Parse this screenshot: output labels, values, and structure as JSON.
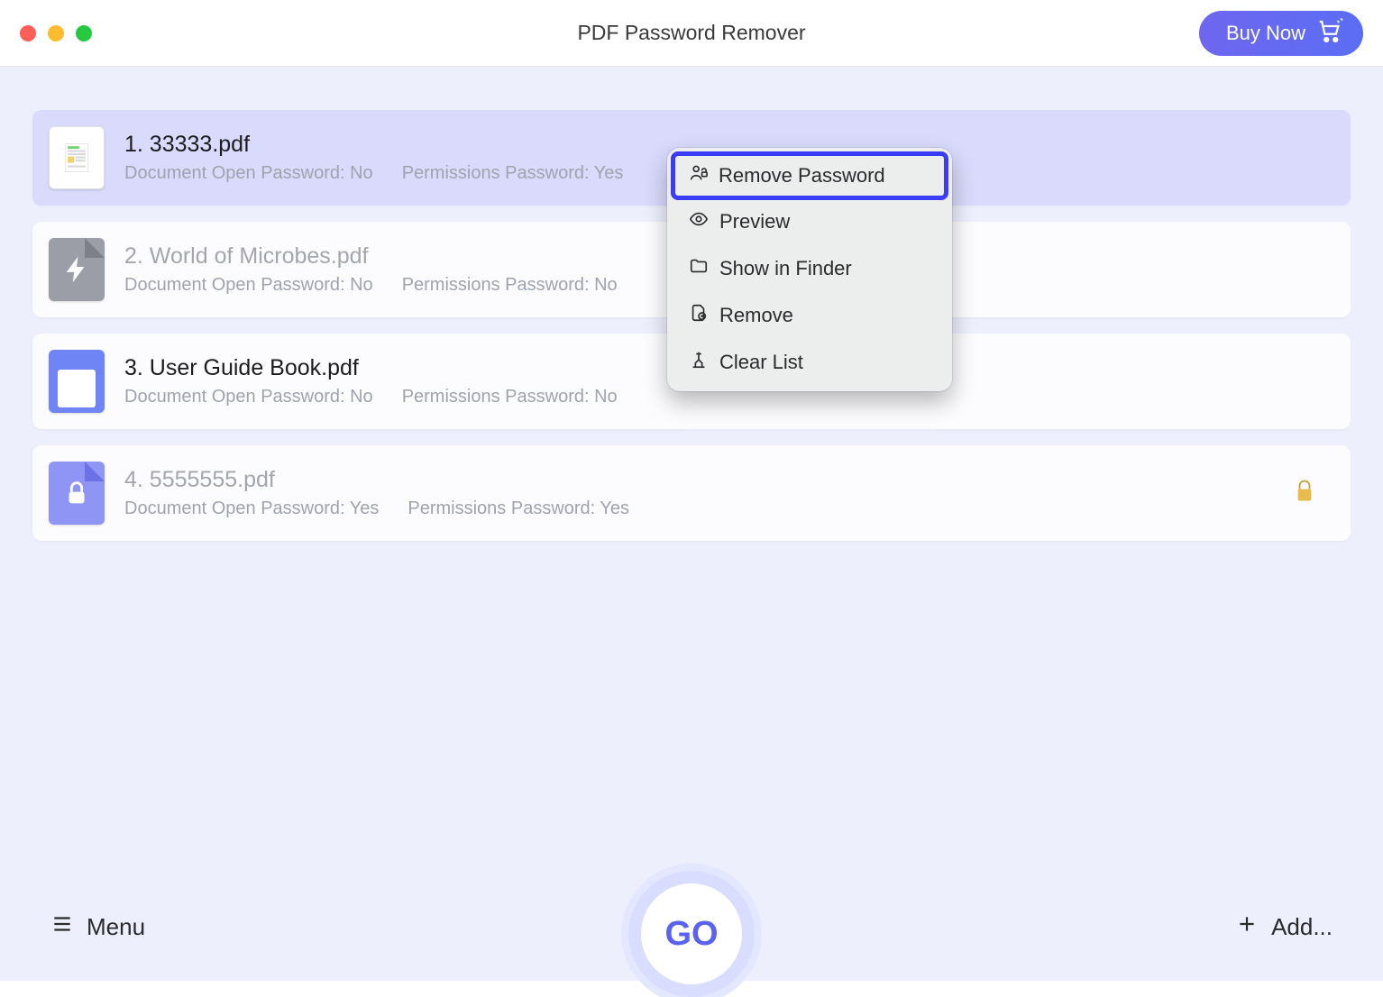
{
  "titlebar": {
    "title": "PDF Password Remover",
    "buy_now": "Buy Now"
  },
  "files": [
    {
      "title": "1. 33333.pdf",
      "open_pw": "Document Open Password: No",
      "perm_pw": "Permissions Password: Yes"
    },
    {
      "title": "2. World of Microbes.pdf",
      "open_pw": "Document Open Password: No",
      "perm_pw": "Permissions Password: No"
    },
    {
      "title": "3. User Guide Book.pdf",
      "open_pw": "Document Open Password: No",
      "perm_pw": "Permissions Password: No"
    },
    {
      "title": "4. 5555555.pdf",
      "open_pw": "Document Open Password: Yes",
      "perm_pw": "Permissions Password: Yes"
    }
  ],
  "context_menu": {
    "remove_password": "Remove Password",
    "preview": "Preview",
    "show_in_finder": "Show in Finder",
    "remove": "Remove",
    "clear_list": "Clear List"
  },
  "bottom": {
    "menu": "Menu",
    "go": "GO",
    "add": "Add..."
  }
}
